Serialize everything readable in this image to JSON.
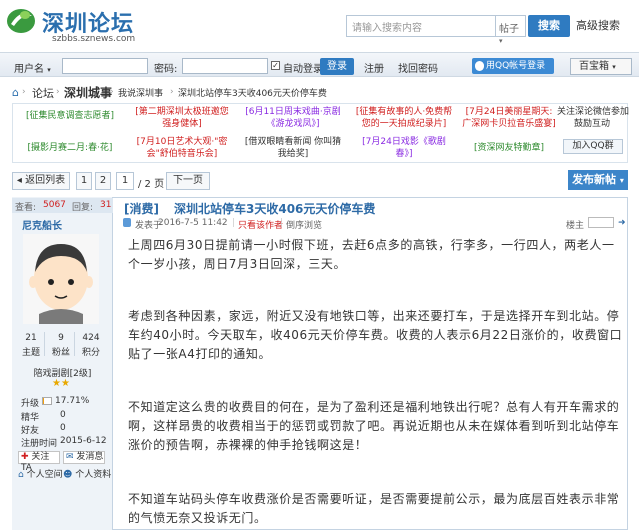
{
  "header": {
    "logo_title": "深圳论坛",
    "logo_sub": "szbbs.sznews.com",
    "search_placeholder": "请输入搜索内容",
    "search_type": "帖子",
    "search_button": "搜索",
    "advanced_search": "高级搜索"
  },
  "loginbar": {
    "username_label": "用户名",
    "password_label": "密码:",
    "auto_login_label": "自动登录",
    "login_button": "登录",
    "register": "注册",
    "find_password": "找回密码",
    "qq_login": "用QQ帐号登录",
    "toolbox": "百宝箱"
  },
  "breadcrumb": {
    "items": [
      "论坛",
      "深圳城事",
      "我说深圳事",
      "深圳北站停车3天收406元天价停车费"
    ]
  },
  "ads": [
    [
      "[征集民意调查志愿者]",
      "[第二期深圳太极班邀您\n强身健体]",
      "[6月11日周末戏曲·京剧\n《游龙戏凤》]",
      "[征集有故事的人·免费帮\n您的一天拍成纪录片]",
      "[7月24日美丽星期天:\n广深网卡贝拉音乐盛宴]",
      "关注深论微信参加\n鼓励互动"
    ],
    [
      "[摄影月赛二月:春·花]",
      "[7月10日艺术大观·\"密\n会\"舒伯特音乐会]",
      "[借双眼睛看新闻 你叫猜\n我给奖]",
      "[7月24日戏影《歌剧\n春》]",
      "[资深网友特勤章]",
      "加入QQ群"
    ]
  ],
  "pager": {
    "back_to_list": "返回列表",
    "page1": "1",
    "page2": "2",
    "current_page": "1",
    "total_pages": "/ 2 页",
    "next_page": "下一页",
    "post_new": "发布新帖"
  },
  "post": {
    "views_label": "查看:",
    "views": "5067",
    "replies_label": "回复:",
    "replies": "31",
    "category": "[消费]",
    "title": "深圳北站停车3天收406元天价停车费",
    "posted_prefix": "发表于",
    "posted_time": "2016-7-5 11:42",
    "only_author": "只看该作者",
    "reverse": "倒序浏览",
    "author_label": "楼主",
    "paragraphs": [
      "上周四6月30日提前请一小时假下班，去赶6点多的高铁，行李多，一行四人，两老人一个一岁小孩，周日7月3日回深，三天。",
      "考虑到各种因素，家远，附近又没有地铁口等，出来还要打车，于是选择开车到北站。停车约40小时。今天取车，收406元天价停车费。收费的人表示6月22日涨价的，收费窗口贴了一张A4打印的通知。",
      "不知道定这么贵的收费目的何在，是为了盈利还是福利地铁出行呢？总有人有开车需求的啊，这样昂贵的收费相当于的惩罚或罚款了吧。再说近期也从未在媒体看到听到北站停车涨价的预告啊，赤裸裸的伸手抢钱啊这是！",
      "不知道车站码头停车收费涨价是否需要听证，是否需要提前公示，最为底层百姓表示非常的气愤无奈又投诉无门。"
    ]
  },
  "author": {
    "name": "尼克船长",
    "topics": "21",
    "topics_label": "主题",
    "fans": "9",
    "fans_label": "粉丝",
    "points": "424",
    "points_label": "积分",
    "rank": "陪戏副剧[2级]",
    "level_label": "升级",
    "level_pct": "17.71%",
    "level_fraction": 0.1771,
    "essence_label": "精华",
    "essence": "0",
    "friends_label": "好友",
    "friends": "0",
    "regtime_label": "注册时间",
    "regtime": "2015-6-12",
    "follow": "关注TA",
    "message": "发消息",
    "personal_space": "个人空间",
    "personal_profile": "个人资料"
  }
}
